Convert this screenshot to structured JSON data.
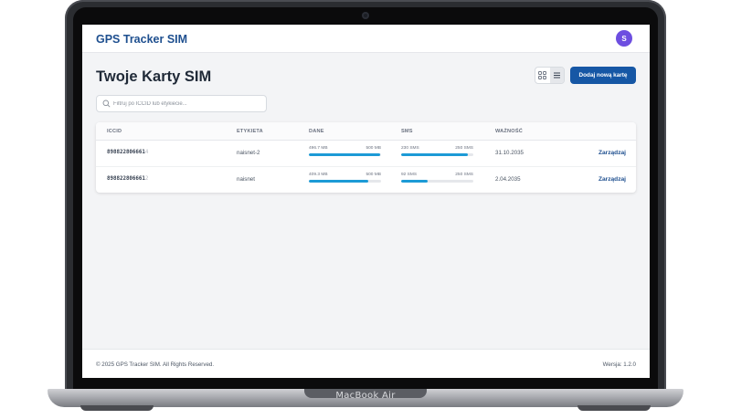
{
  "app": {
    "brand": "GPS Tracker SIM",
    "avatar_initial": "S"
  },
  "page": {
    "title": "Twoje Karty SIM"
  },
  "toolbar": {
    "add_label": "Dodaj nową kartę",
    "grid_icon": "grid-icon",
    "list_icon": "list-icon",
    "active_view": "list"
  },
  "search": {
    "placeholder": "Filtruj po ICCID lub etykiecie...",
    "value": ""
  },
  "table": {
    "headers": {
      "iccid": "ICCID",
      "label": "ETYKIETA",
      "data": "DANE",
      "sms": "SMS",
      "validity": "WAŻNOŚĆ"
    },
    "rows": [
      {
        "iccid_visible": "898822806661",
        "iccid_faded": "4",
        "label": "naisnet-2",
        "data_used": "496.7 MB",
        "data_total": "500 MB",
        "data_fraction": 0.993,
        "sms_used": "230 SMS",
        "sms_total": "250 SMS",
        "sms_fraction": 0.92,
        "validity": "31.10.2035",
        "action": "Zarządzaj"
      },
      {
        "iccid_visible": "898822806661",
        "iccid_faded": "2",
        "label": "naisnet",
        "data_used": "409.3 MB",
        "data_total": "500 MB",
        "data_fraction": 0.819,
        "sms_used": "92 SMS",
        "sms_total": "250 SMS",
        "sms_fraction": 0.368,
        "validity": "2.04.2035",
        "action": "Zarządzaj"
      }
    ]
  },
  "footer": {
    "copyright": "© 2025 GPS Tracker SIM. All Rights Reserved.",
    "version": "Wersja: 1.2.0"
  },
  "device": {
    "model": "MacBook Air"
  },
  "colors": {
    "primary": "#1657a5",
    "brand": "#1e4f8f",
    "bar": "#1c9ad6",
    "avatar": "#6d4ee0"
  }
}
